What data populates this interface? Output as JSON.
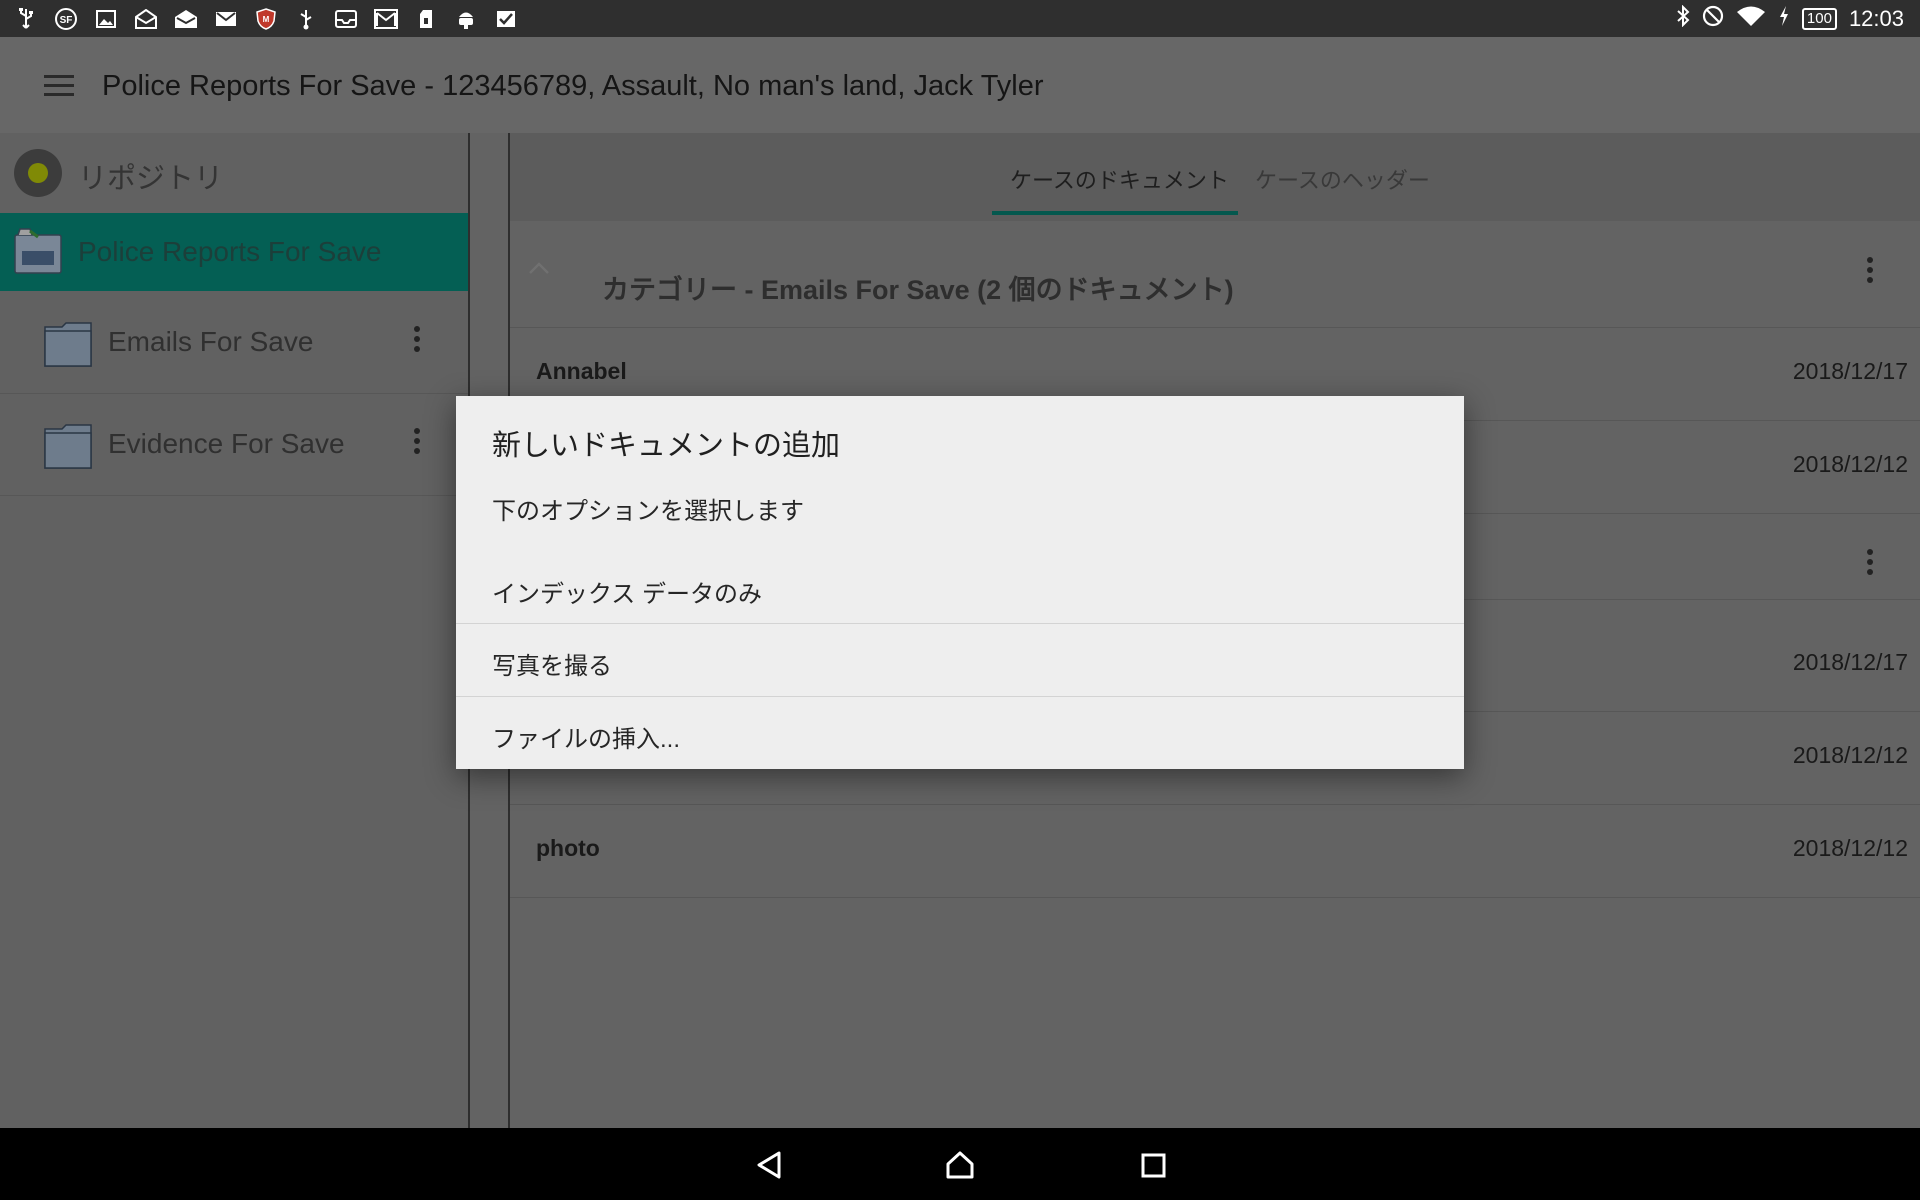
{
  "status_bar": {
    "left_icons": [
      "usb-icon",
      "sf-app-icon",
      "image-icon",
      "mail-open-icon",
      "mail-open-alt-icon",
      "gmail-icon",
      "mcafee-icon",
      "usb-debug-icon",
      "inbox-icon",
      "gmail-alt-icon",
      "sd-card-icon",
      "android-icon",
      "task-check-icon"
    ],
    "battery": "100",
    "time": "12:03"
  },
  "app_bar": {
    "title": "Police Reports For Save - 123456789, Assault, No man's land, Jack Tyler"
  },
  "sidebar": {
    "repository_label": "リポジトリ",
    "case_label": "Police Reports For Save",
    "folders": [
      {
        "label": "Emails For Save"
      },
      {
        "label": "Evidence For Save"
      }
    ]
  },
  "main": {
    "tabs": [
      {
        "label": "ケースのドキュメント",
        "active": true
      },
      {
        "label": "ケースのヘッダー",
        "active": false
      }
    ],
    "category_title": "カテゴリー - Emails For Save (2 個のドキュメント)",
    "documents": [
      {
        "name": "Annabel",
        "date": "2018/12/17"
      },
      {
        "name": "",
        "date": "2018/12/12"
      },
      {
        "name": "",
        "date": "2018/12/17"
      },
      {
        "name": "",
        "date": "2018/12/12"
      },
      {
        "name": "photo",
        "date": "2018/12/12"
      }
    ]
  },
  "dialog": {
    "title": "新しいドキュメントの追加",
    "subtitle": "下のオプションを選択します",
    "options": [
      {
        "label": "インデックス データのみ"
      },
      {
        "label": "写真を撮る"
      },
      {
        "label": "ファイルの挿入..."
      }
    ]
  },
  "colors": {
    "accent": "#045f54",
    "dim_background": "#636363",
    "dialog_background": "#eeeeee"
  }
}
